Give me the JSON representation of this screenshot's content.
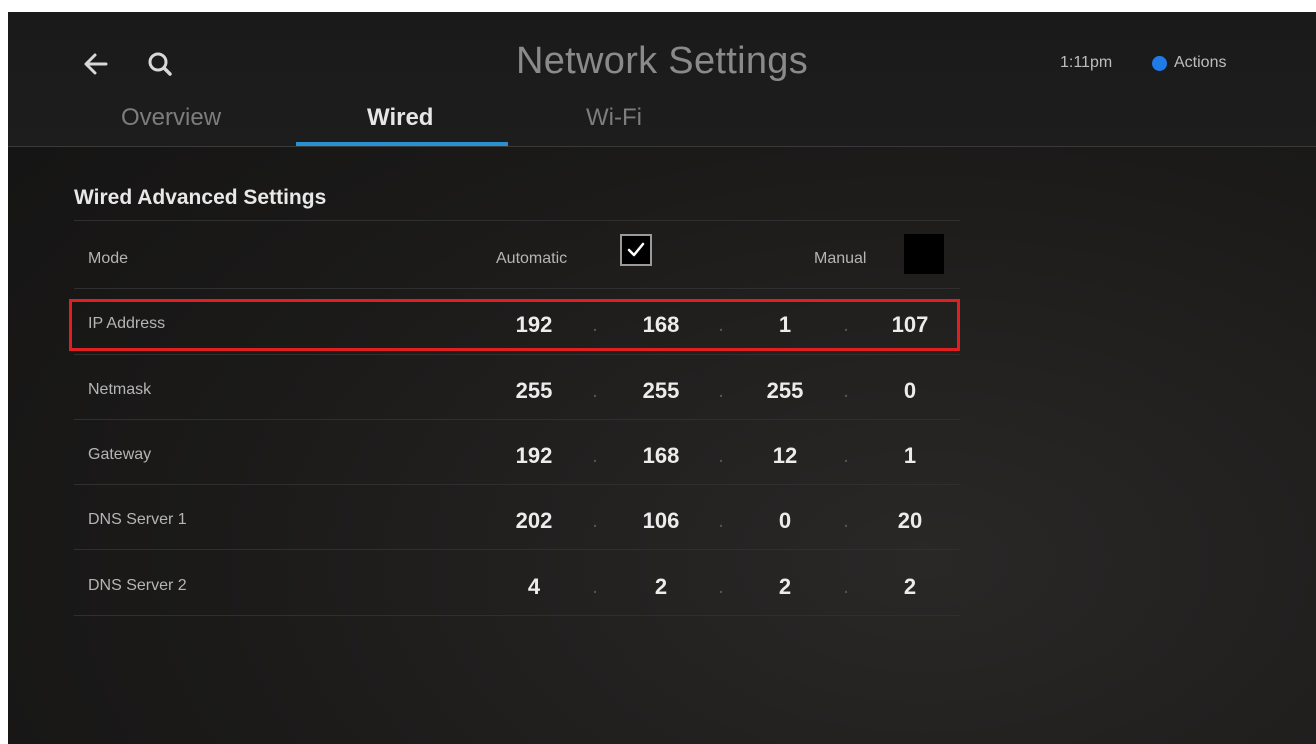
{
  "header": {
    "title": "Network Settings",
    "time": "1:11pm",
    "actions_label": "Actions",
    "tabs": [
      {
        "label": "Overview",
        "selected": false
      },
      {
        "label": "Wired",
        "selected": true
      },
      {
        "label": "Wi-Fi",
        "selected": false
      }
    ]
  },
  "settings": {
    "section_title": "Wired Advanced Settings",
    "mode": {
      "label": "Mode",
      "automatic_label": "Automatic",
      "automatic_checked": true,
      "manual_label": "Manual",
      "manual_checked": false
    },
    "separator": ".",
    "rows": [
      {
        "label": "IP Address",
        "octets": [
          "192",
          "168",
          "1",
          "107"
        ],
        "highlighted": true
      },
      {
        "label": "Netmask",
        "octets": [
          "255",
          "255",
          "255",
          "0"
        ]
      },
      {
        "label": "Gateway",
        "octets": [
          "192",
          "168",
          "12",
          "1"
        ]
      },
      {
        "label": "DNS Server 1",
        "octets": [
          "202",
          "106",
          "0",
          "20"
        ]
      },
      {
        "label": "DNS Server 2",
        "octets": [
          "4",
          "2",
          "2",
          "2"
        ]
      }
    ]
  },
  "colors": {
    "accent": "#2891d2",
    "actions_dot": "#1f7be8",
    "highlight_border": "#e02020"
  }
}
